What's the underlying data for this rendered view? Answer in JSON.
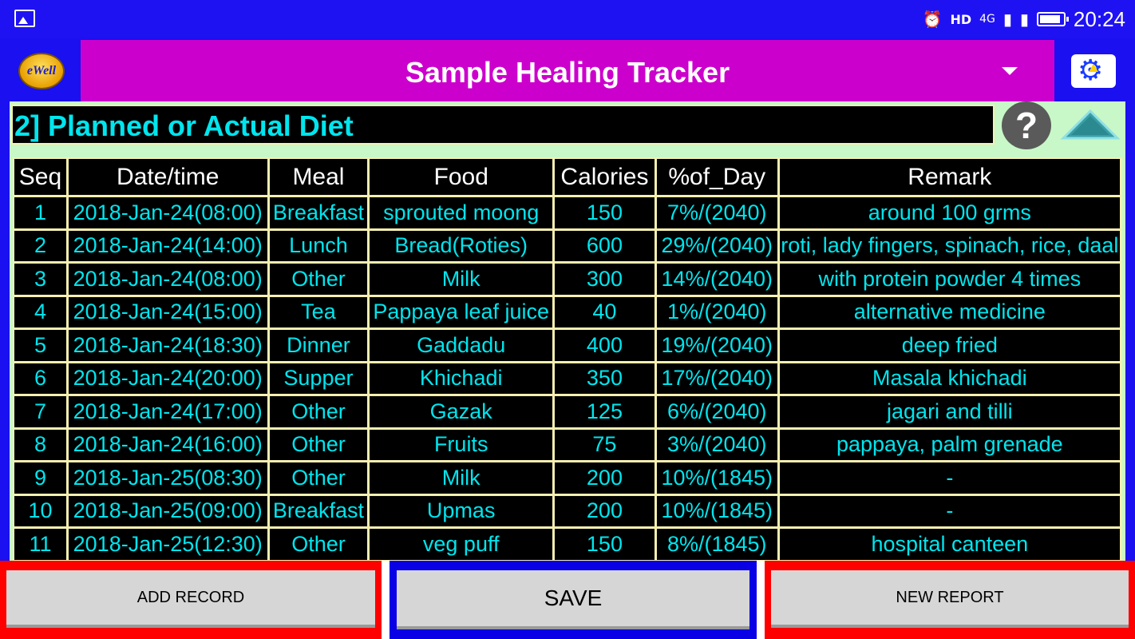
{
  "status_bar": {
    "time": "20:24",
    "network": "4G",
    "hd": "HD"
  },
  "app": {
    "logo_text": "eWell",
    "title": "Sample Healing Tracker"
  },
  "section": {
    "title": "2] Planned or Actual Diet",
    "help_label": "?"
  },
  "table": {
    "columns": [
      "Seq",
      "Date/time",
      "Meal",
      "Food",
      "Calories",
      "%of_Day",
      "Remark"
    ],
    "rows": [
      [
        "1",
        "2018-Jan-24(08:00)",
        "Breakfast",
        "sprouted moong",
        "150",
        "7%/(2040)",
        "around 100 grms"
      ],
      [
        "2",
        "2018-Jan-24(14:00)",
        "Lunch",
        "Bread(Roties)",
        "600",
        "29%/(2040)",
        "roti, lady fingers, spinach, rice, daal"
      ],
      [
        "3",
        "2018-Jan-24(08:00)",
        "Other",
        "Milk",
        "300",
        "14%/(2040)",
        "with protein powder 4 times"
      ],
      [
        "4",
        "2018-Jan-24(15:00)",
        "Tea",
        "Pappaya leaf juice",
        "40",
        "1%/(2040)",
        "alternative medicine"
      ],
      [
        "5",
        "2018-Jan-24(18:30)",
        "Dinner",
        "Gaddadu",
        "400",
        "19%/(2040)",
        "deep fried"
      ],
      [
        "6",
        "2018-Jan-24(20:00)",
        "Supper",
        "Khichadi",
        "350",
        "17%/(2040)",
        "Masala khichadi"
      ],
      [
        "7",
        "2018-Jan-24(17:00)",
        "Other",
        "Gazak",
        "125",
        "6%/(2040)",
        "jagari and tilli"
      ],
      [
        "8",
        "2018-Jan-24(16:00)",
        "Other",
        "Fruits",
        "75",
        "3%/(2040)",
        "pappaya, palm grenade"
      ],
      [
        "9",
        "2018-Jan-25(08:30)",
        "Other",
        "Milk",
        "200",
        "10%/(1845)",
        "-"
      ],
      [
        "10",
        "2018-Jan-25(09:00)",
        "Breakfast",
        "Upmas",
        "200",
        "10%/(1845)",
        "-"
      ],
      [
        "11",
        "2018-Jan-25(12:30)",
        "Other",
        "veg puff",
        "150",
        "8%/(1845)",
        "hospital canteen"
      ]
    ]
  },
  "buttons": {
    "add_record": "ADD RECORD",
    "save": "SAVE",
    "new_report": "NEW REPORT"
  },
  "colors": {
    "background": "#1a10f0",
    "title_bar": "#cc00cc",
    "panel": "#c8f8c8",
    "cell_text": "#00e5ee",
    "grid_line": "#f6f0b0",
    "add_border": "#ff0000",
    "save_border": "#0a00e6"
  }
}
